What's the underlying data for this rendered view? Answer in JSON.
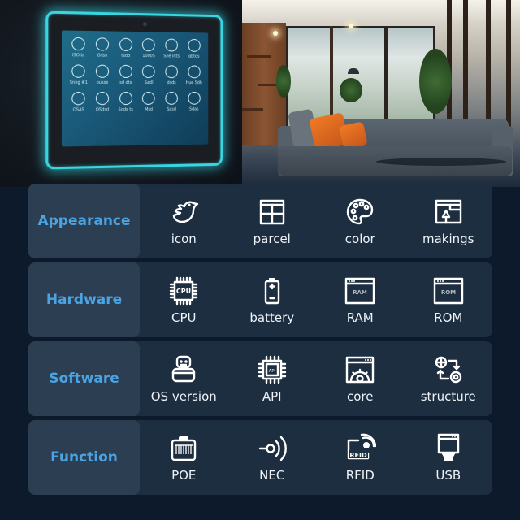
{
  "hero": {
    "tablet": {
      "apps": [
        {
          "label": "ISO bt"
        },
        {
          "label": "Gdsn"
        },
        {
          "label": "tsdd"
        },
        {
          "label": "10005"
        },
        {
          "label": "Sne ldts"
        },
        {
          "label": "qbtds"
        },
        {
          "label": "Snng #1"
        },
        {
          "label": "ousse"
        },
        {
          "label": "sd dts"
        },
        {
          "label": "Sadl"
        },
        {
          "label": "dsds"
        },
        {
          "label": "Hue Sdh"
        },
        {
          "label": "OSAS"
        },
        {
          "label": "OSdsd"
        },
        {
          "label": "Sdds ts"
        },
        {
          "label": "Msd"
        },
        {
          "label": "Sasd"
        },
        {
          "label": "Sdas"
        }
      ]
    }
  },
  "sections": [
    {
      "category": "Appearance",
      "items": [
        {
          "icon": "bird-icon",
          "label": "icon"
        },
        {
          "icon": "grid-box-icon",
          "label": "parcel"
        },
        {
          "icon": "palette-icon",
          "label": "color"
        },
        {
          "icon": "window-shape-icon",
          "label": "makings"
        }
      ]
    },
    {
      "category": "Hardware",
      "items": [
        {
          "icon": "cpu-chip-icon",
          "label": "CPU",
          "icon_text": "CPU"
        },
        {
          "icon": "battery-icon",
          "label": "battery"
        },
        {
          "icon": "ram-window-icon",
          "label": "RAM",
          "icon_text": "RAM"
        },
        {
          "icon": "rom-window-icon",
          "label": "ROM",
          "icon_text": "ROM"
        }
      ]
    },
    {
      "category": "Software",
      "items": [
        {
          "icon": "robot-icon",
          "label": "OS version"
        },
        {
          "icon": "api-chip-icon",
          "label": "API",
          "icon_text": "API"
        },
        {
          "icon": "window-gear-icon",
          "label": "core"
        },
        {
          "icon": "structure-cycle-icon",
          "label": "structure"
        }
      ]
    },
    {
      "category": "Function",
      "items": [
        {
          "icon": "ethernet-port-icon",
          "label": "POE"
        },
        {
          "icon": "nfc-signal-icon",
          "label": "NEC"
        },
        {
          "icon": "rfid-card-icon",
          "label": "RFID",
          "icon_text": "RFID"
        },
        {
          "icon": "usb-connector-icon",
          "label": "USB"
        }
      ]
    }
  ],
  "colors": {
    "category_text": "#4ba3e3",
    "tablet_glow": "#38d6e0",
    "pillow": "#f07a24"
  }
}
